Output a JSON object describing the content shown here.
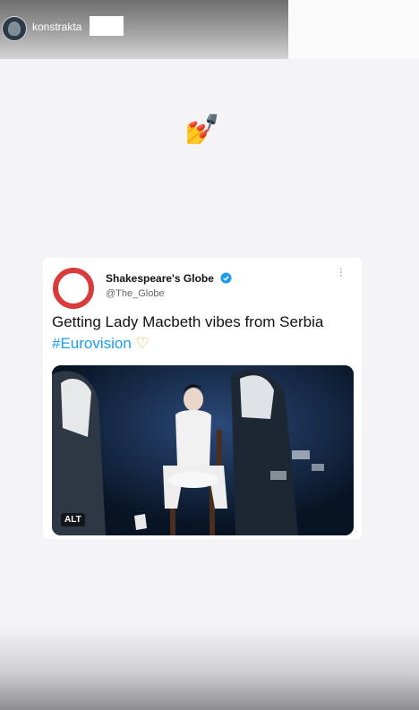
{
  "story": {
    "username": "konstrakta"
  },
  "sticker": {
    "emoji": "💅"
  },
  "tweet": {
    "account_name": "Shakespeare's Globe",
    "handle": "@The_Globe",
    "text": "Getting Lady Macbeth vibes from Serbia",
    "hashtag": "#Eurovision",
    "heart": "♡",
    "more_glyph": "···",
    "image_alt_badge": "ALT"
  },
  "colors": {
    "globe_red": "#d93a3a",
    "hashtag_blue": "#1d9bf0",
    "verified_blue": "#1d9bf0",
    "heart_gold": "#e8b93a"
  }
}
